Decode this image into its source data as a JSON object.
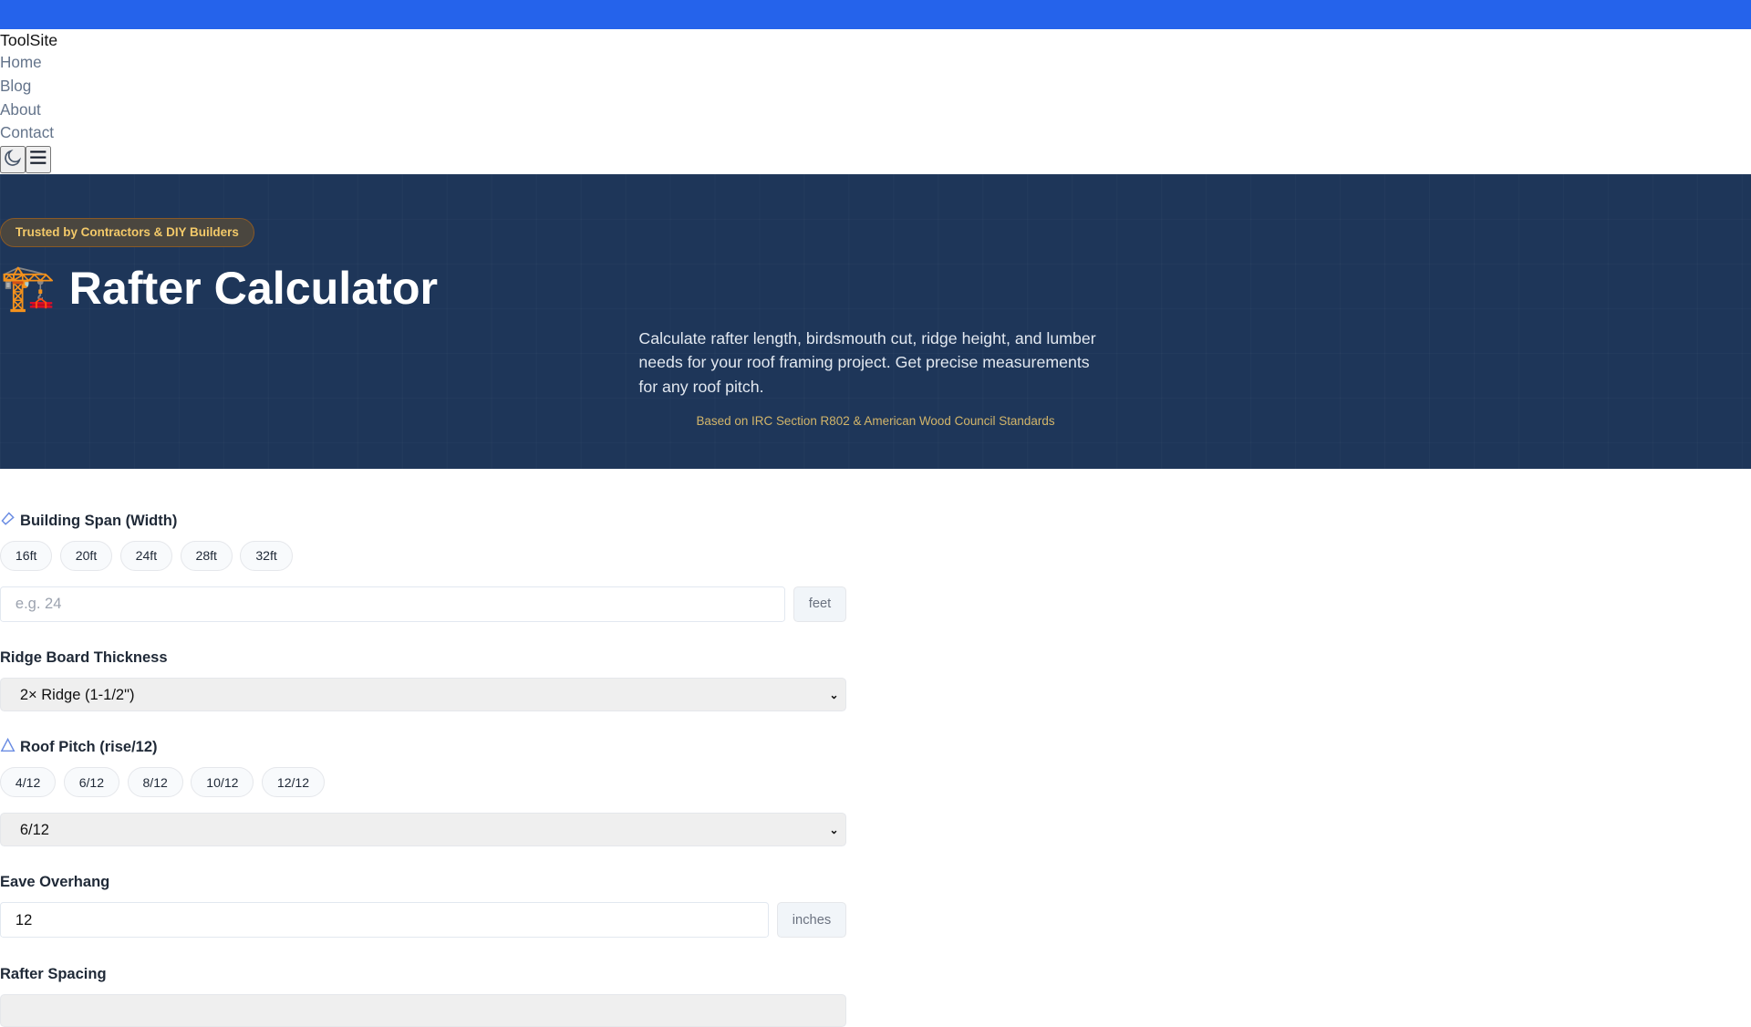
{
  "header": {
    "brand": "ToolSite",
    "nav": [
      "Home",
      "Blog",
      "About",
      "Contact"
    ]
  },
  "hero": {
    "badge": "Trusted by Contractors & DIY Builders",
    "emoji": "🏗️",
    "title": "Rafter Calculator",
    "description": "Calculate rafter length, birdsmouth cut, ridge height, and lumber needs for your roof framing project. Get precise measurements for any roof pitch.",
    "note": "Based on IRC Section R802 & American Wood Council Standards"
  },
  "form": {
    "span": {
      "label": "Building Span (Width)",
      "presets": [
        "16ft",
        "20ft",
        "24ft",
        "28ft",
        "32ft"
      ],
      "placeholder": "e.g. 24",
      "unit": "feet"
    },
    "ridge": {
      "label": "Ridge Board Thickness",
      "value": "2× Ridge (1-1/2\")"
    },
    "pitch": {
      "label": "Roof Pitch (rise/12)",
      "presets": [
        "4/12",
        "6/12",
        "8/12",
        "10/12",
        "12/12"
      ],
      "value": "6/12"
    },
    "overhang": {
      "label": "Eave Overhang",
      "value": "12",
      "unit": "inches"
    },
    "spacing": {
      "label": "Rafter Spacing"
    }
  },
  "colors": {
    "topbar": "#2563eb",
    "hero": "#1e3659",
    "badge_text": "#f3c969"
  }
}
